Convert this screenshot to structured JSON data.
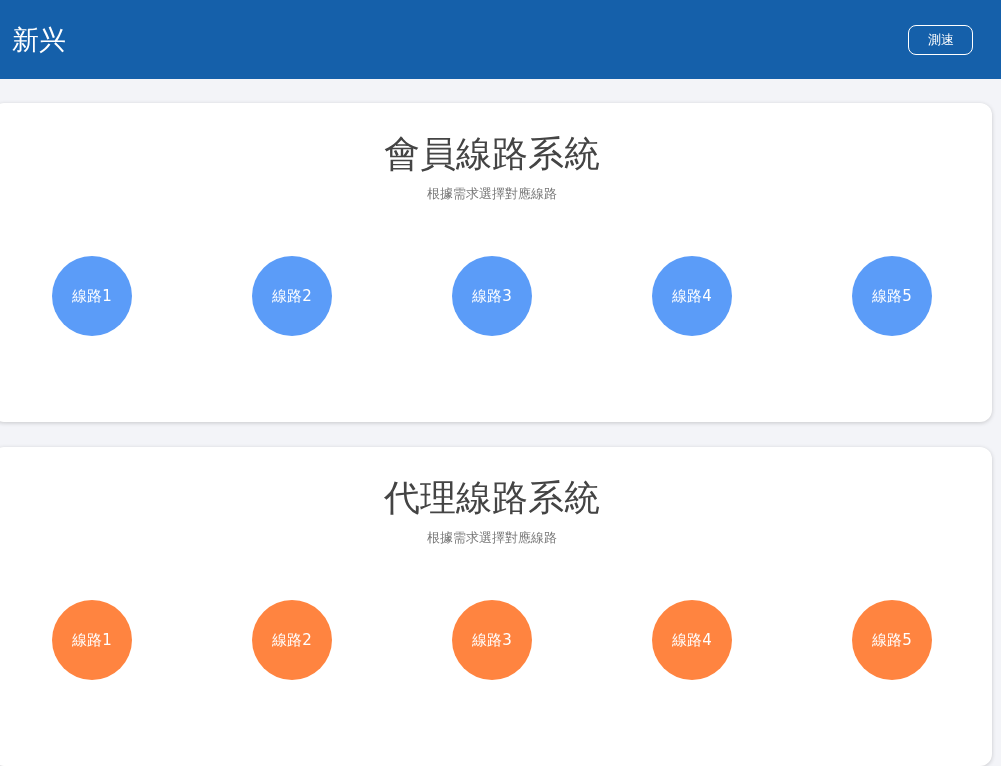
{
  "header": {
    "title": "新兴",
    "button": "測速"
  },
  "sections": [
    {
      "title": "會員線路系統",
      "subtitle": "根據需求選擇對應線路",
      "color": "#5b9cf8",
      "lines": [
        "線路1",
        "線路2",
        "線路3",
        "線路4",
        "線路5"
      ]
    },
    {
      "title": "代理線路系統",
      "subtitle": "根據需求選擇對應線路",
      "color": "#ff8440",
      "lines": [
        "線路1",
        "線路2",
        "線路3",
        "線路4",
        "線路5"
      ]
    }
  ]
}
